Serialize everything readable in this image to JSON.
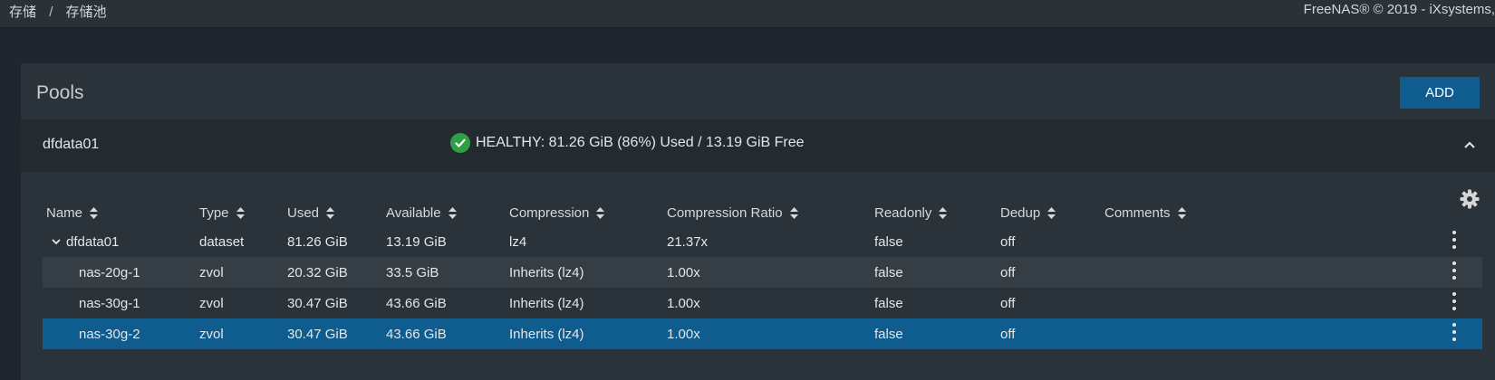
{
  "breadcrumb": {
    "items": [
      "存储",
      "存储池"
    ],
    "separator": "/"
  },
  "footer": {
    "copyright": "FreeNAS® © 2019 - iXsystems,"
  },
  "pools": {
    "title": "Pools",
    "add_label": "ADD",
    "pool": {
      "name": "dfdata01",
      "status": "HEALTHY: 81.26 GiB (86%) Used / 13.19 GiB Free"
    }
  },
  "table": {
    "columns": [
      "Name",
      "Type",
      "Used",
      "Available",
      "Compression",
      "Compression Ratio",
      "Readonly",
      "Dedup",
      "Comments"
    ],
    "rows": [
      {
        "name": "dfdata01",
        "type": "dataset",
        "used": "81.26 GiB",
        "available": "13.19 GiB",
        "compression": "lz4",
        "ratio": "21.37x",
        "readonly": "false",
        "dedup": "off",
        "comments": ""
      },
      {
        "name": "nas-20g-1",
        "type": "zvol",
        "used": "20.32 GiB",
        "available": "33.5 GiB",
        "compression": "Inherits (lz4)",
        "ratio": "1.00x",
        "readonly": "false",
        "dedup": "off",
        "comments": ""
      },
      {
        "name": "nas-30g-1",
        "type": "zvol",
        "used": "30.47 GiB",
        "available": "43.66 GiB",
        "compression": "Inherits (lz4)",
        "ratio": "1.00x",
        "readonly": "false",
        "dedup": "off",
        "comments": ""
      },
      {
        "name": "nas-30g-2",
        "type": "zvol",
        "used": "30.47 GiB",
        "available": "43.66 GiB",
        "compression": "Inherits (lz4)",
        "ratio": "1.00x",
        "readonly": "false",
        "dedup": "off",
        "comments": ""
      }
    ]
  },
  "colors": {
    "accent": "#0f5c8f",
    "healthy": "#2ea043"
  }
}
